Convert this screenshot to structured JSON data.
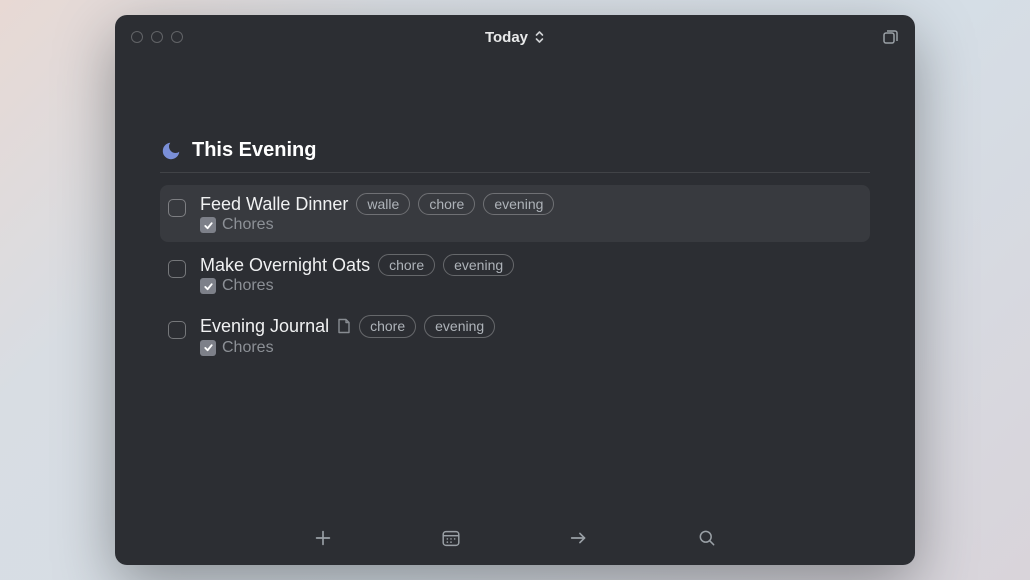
{
  "window": {
    "title": "Today"
  },
  "section": {
    "title": "This Evening"
  },
  "tasks": [
    {
      "title": "Feed Walle Dinner",
      "tags": [
        "walle",
        "chore",
        "evening"
      ],
      "area": "Chores",
      "has_note": false,
      "selected": true
    },
    {
      "title": "Make Overnight Oats",
      "tags": [
        "chore",
        "evening"
      ],
      "area": "Chores",
      "has_note": false,
      "selected": false
    },
    {
      "title": "Evening Journal",
      "tags": [
        "chore",
        "evening"
      ],
      "area": "Chores",
      "has_note": true,
      "selected": false
    }
  ]
}
